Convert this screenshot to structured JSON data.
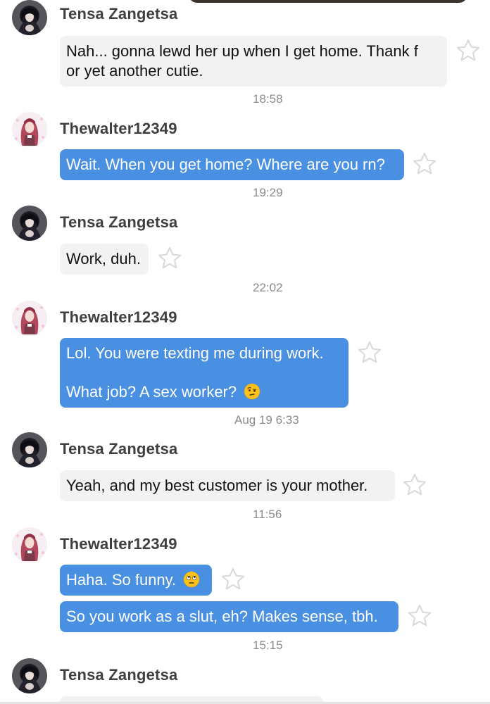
{
  "participants": {
    "tensa": {
      "name": "Tensa Zangetsa",
      "avatar": "dark-haired-character-avatar"
    },
    "walter": {
      "name": "Thewalter12349",
      "avatar": "pink-haired-character-avatar"
    }
  },
  "messages": [
    {
      "sender": "Tensa Zangetsa",
      "lines": [
        "Nah... gonna lewd her up when I get home. Thank f",
        "or yet another cutie."
      ],
      "time": "18:58"
    },
    {
      "sender": "Thewalter12349",
      "lines": [
        "Wait. When you get home? Where are you rn?"
      ],
      "time": "19:29"
    },
    {
      "sender": "Tensa Zangetsa",
      "lines": [
        "Work, duh."
      ],
      "time": "22:02"
    },
    {
      "sender": "Thewalter12349",
      "lines": [
        "Lol. You were texting me during work.",
        "What job? A sex worker?"
      ],
      "emoji": "raised-eyebrow-face",
      "time": "Aug 19 6:33"
    },
    {
      "sender": "Tensa Zangetsa",
      "lines": [
        "Yeah, and my best customer is your mother."
      ],
      "time": "11:56"
    },
    {
      "sender": "Thewalter12349",
      "lines": [
        "Haha. So funny."
      ],
      "emoji": "eye-roll-face"
    },
    {
      "sender": "Thewalter12349",
      "lines": [
        "So you work as a slut, eh? Makes sense, tbh."
      ],
      "time": "15:15"
    },
    {
      "sender": "Tensa Zangetsa",
      "lines": []
    }
  ],
  "colors": {
    "outgoing_bubble": "#4a90e2",
    "incoming_bubble": "#f2f2f2",
    "timestamp": "#8a8a8a",
    "name": "#3f3f3f"
  },
  "icons": {
    "favorite": "star-outline-icon"
  }
}
